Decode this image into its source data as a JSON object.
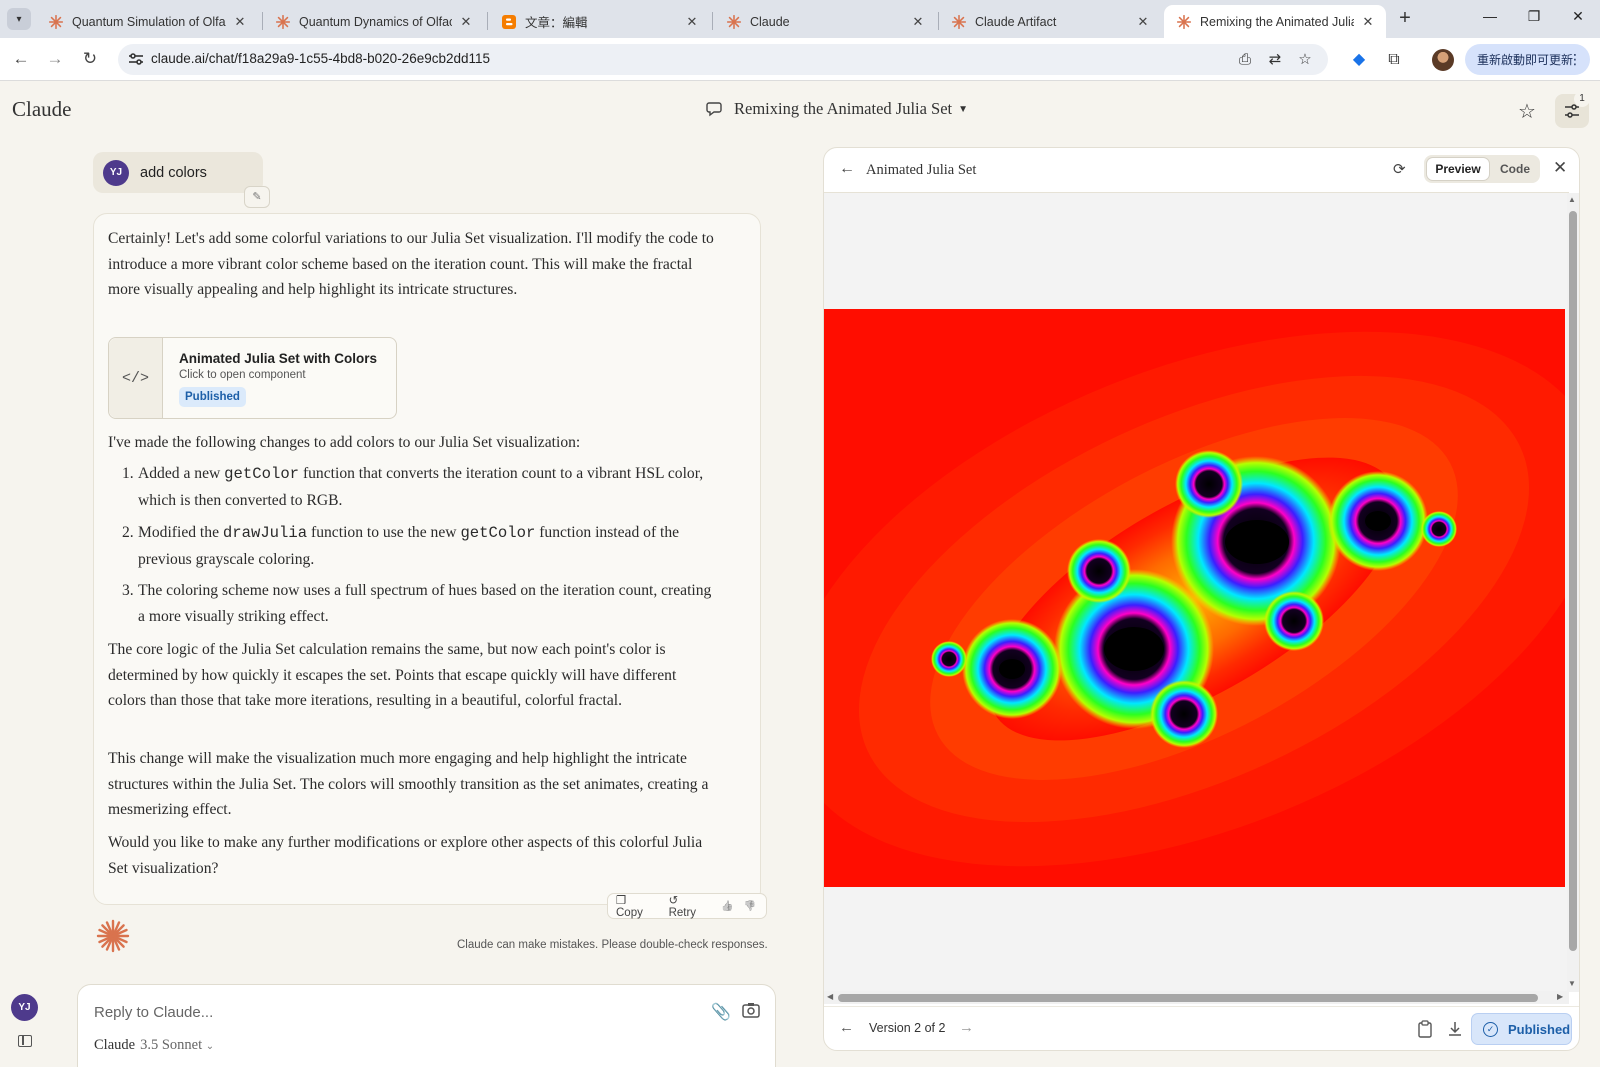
{
  "browser": {
    "tabs": [
      {
        "title": "Quantum Simulation of Olfac",
        "favicon": "claude-spark-icon"
      },
      {
        "title": "Quantum Dynamics of Olfact",
        "favicon": "claude-spark-icon"
      },
      {
        "title": "文章：編輯",
        "favicon": "blogger-icon"
      },
      {
        "title": "Claude",
        "favicon": "claude-spark-icon"
      },
      {
        "title": "Claude Artifact",
        "favicon": "claude-spark-icon"
      },
      {
        "title": "Remixing the Animated Julia",
        "favicon": "claude-spark-icon"
      }
    ],
    "active_tab": 5,
    "new_tab": "+",
    "window_controls": {
      "minimize": "—",
      "restore": "❐",
      "close": "✕"
    },
    "url": "claude.ai/chat/f18a29a9-1c55-4bd8-b020-26e9cb2dd115",
    "update_button": "重新啟動即可更新",
    "update_menu": "⋮"
  },
  "app": {
    "logo": "Claude",
    "conversation_title": "Remixing the Animated Julia Set",
    "notification_count": "1"
  },
  "chat": {
    "user": {
      "initials": "YJ",
      "message": "add colors",
      "edit_icon": "✎"
    },
    "ai": {
      "intro": "Certainly! Let's add some colorful variations to our Julia Set visualization. I'll modify the code to introduce a more vibrant color scheme based on the iteration count. This will make the fractal more visually appealing and help highlight its intricate structures.",
      "artifact": {
        "icon": "</>",
        "title": "Animated Julia Set with Colors",
        "subtitle": "Click to open component",
        "badge": "Published"
      },
      "changes_intro": "I've made the following changes to add colors to our Julia Set visualization:",
      "list": [
        {
          "num": "1.",
          "a": "Added a new ",
          "code1": "getColor",
          "b": " function that converts the iteration count to a vibrant HSL color, which is then converted to RGB.",
          "code2": "",
          "c": ""
        },
        {
          "num": "2.",
          "a": "Modified the ",
          "code1": "drawJulia",
          "b": " function to use the new ",
          "code2": "getColor",
          "c": " function instead of the previous grayscale coloring."
        },
        {
          "num": "3.",
          "a": "The coloring scheme now uses a full spectrum of hues based on the iteration count, creating a more visually striking effect.",
          "code1": "",
          "b": "",
          "code2": "",
          "c": ""
        }
      ],
      "para_core": "The core logic of the Julia Set calculation remains the same, but now each point's color is determined by how quickly it escapes the set. Points that escape quickly will have different colors than those that take more iterations, resulting in a beautiful, colorful fractal.",
      "para_change": "This change will make the visualization much more engaging and help highlight the intricate structures within the Julia Set. The colors will smoothly transition as the set animates, creating a mesmerizing effect.",
      "para_question": "Would you like to make any further modifications or explore other aspects of this colorful Julia Set visualization?",
      "actions": {
        "copy": "Copy",
        "retry": "Retry",
        "thumbs_up": "👍",
        "thumbs_down": "👎"
      },
      "disclaimer": "Claude can make mistakes. Please double-check responses."
    },
    "sidebar_avatar": "YJ",
    "composer": {
      "placeholder": "Reply to Claude...",
      "model_name": "Claude",
      "model_version": "3.5 Sonnet"
    }
  },
  "artifact_panel": {
    "title": "Animated Julia Set",
    "tabs": {
      "preview": "Preview",
      "code": "Code"
    },
    "active_tab": "preview",
    "version_label": "Version 2 of 2",
    "publish_button": "Published",
    "colors": {
      "background": "#ff0d00",
      "accent": "#1d5fa8"
    }
  }
}
